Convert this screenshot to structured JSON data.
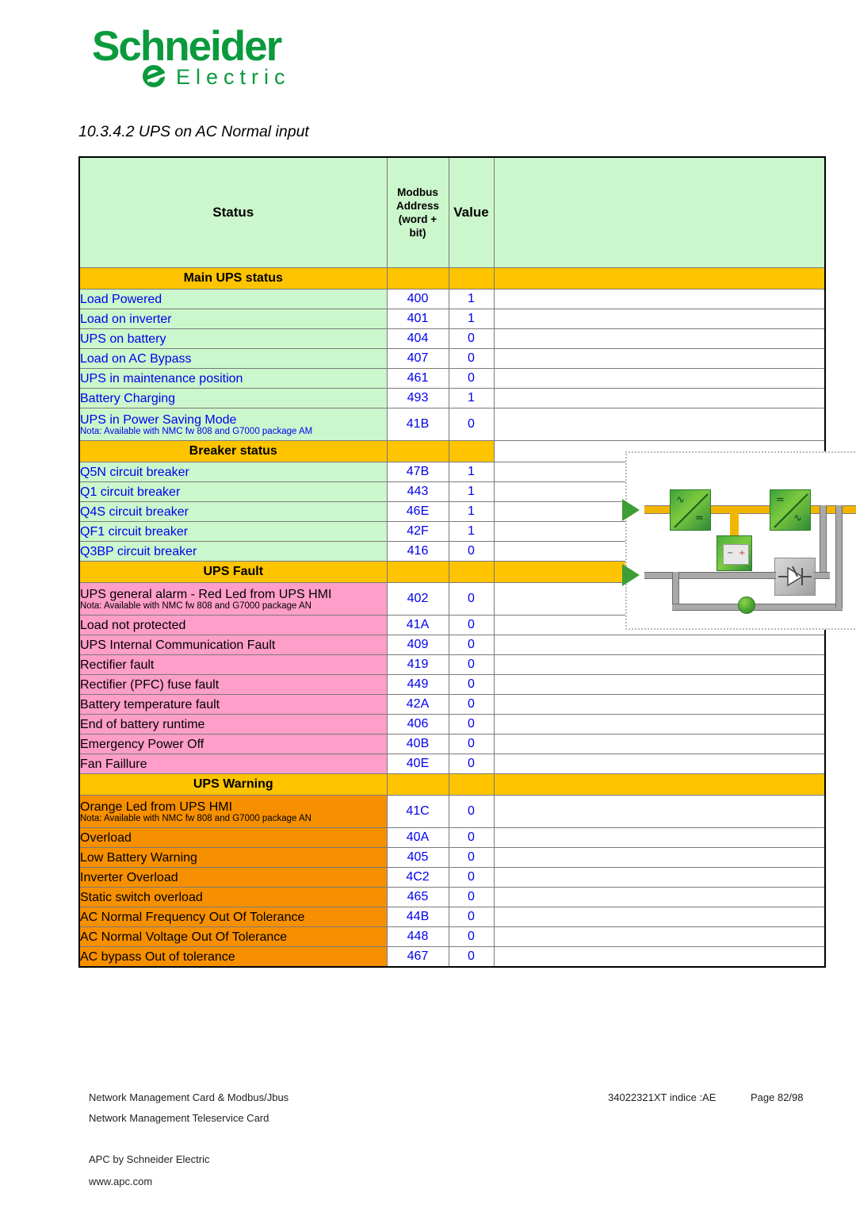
{
  "brand": {
    "name": "Schneider",
    "sub": "Electric",
    "green": "#0a9a3c"
  },
  "heading": "10.3.4.2 UPS on AC Normal input",
  "table": {
    "headers": {
      "status": "Status",
      "address": "Modbus Address (word + bit)",
      "address_lines": [
        "Modbus",
        "Address",
        "(word +",
        "bit)"
      ],
      "value": "Value",
      "diagram": ""
    },
    "sections": [
      {
        "title": "Main UPS status",
        "band_spans_diagram": true,
        "color": "#ccf6cc",
        "text_color": "#0000ee",
        "rows": [
          {
            "label": "Load Powered",
            "note": "",
            "address": "400",
            "value": "1"
          },
          {
            "label": "Load on inverter",
            "note": "",
            "address": "401",
            "value": "1"
          },
          {
            "label": "UPS on battery",
            "note": "",
            "address": "404",
            "value": "0"
          },
          {
            "label": "Load on AC Bypass",
            "note": "",
            "address": "407",
            "value": "0"
          },
          {
            "label": "UPS in maintenance position",
            "note": "",
            "address": "461",
            "value": "0"
          },
          {
            "label": "Battery Charging",
            "note": "",
            "address": "493",
            "value": "1"
          },
          {
            "label": "UPS in Power Saving Mode",
            "note": "Nota: Available with NMC fw 808 and G7000 package AM",
            "address": "41B",
            "value": "0"
          }
        ]
      },
      {
        "title": "Breaker status",
        "band_spans_diagram": false,
        "color": "#ccf6cc",
        "text_color": "#0000ee",
        "rows": [
          {
            "label": "Q5N circuit breaker",
            "note": "",
            "address": "47B",
            "value": "1"
          },
          {
            "label": "Q1 circuit breaker",
            "note": "",
            "address": "443",
            "value": "1"
          },
          {
            "label": "Q4S circuit breaker",
            "note": "",
            "address": "46E",
            "value": "1"
          },
          {
            "label": "QF1 circuit breaker",
            "note": "",
            "address": "42F",
            "value": "1"
          },
          {
            "label": "Q3BP circuit breaker",
            "note": "",
            "address": "416",
            "value": "0"
          }
        ]
      },
      {
        "title": "UPS Fault",
        "band_spans_diagram": true,
        "color": "#ff9ec8",
        "text_color": "#000000",
        "rows": [
          {
            "label": "UPS general alarm - Red Led from UPS HMI",
            "note": "Nota: Available with NMC fw 808 and G7000 package AN",
            "address": "402",
            "value": "0"
          },
          {
            "label": "Load not protected",
            "note": "",
            "address": "41A",
            "value": "0"
          },
          {
            "label": "UPS Internal Communication Fault",
            "note": "",
            "address": "409",
            "value": "0"
          },
          {
            "label": "Rectifier fault",
            "note": "",
            "address": "419",
            "value": "0"
          },
          {
            "label": "Rectifier (PFC) fuse fault",
            "note": "",
            "address": "449",
            "value": "0"
          },
          {
            "label": "Battery temperature fault",
            "note": "",
            "address": "42A",
            "value": "0"
          },
          {
            "label": "End of battery runtime",
            "note": "",
            "address": "406",
            "value": "0"
          },
          {
            "label": "Emergency Power Off",
            "note": "",
            "address": "40B",
            "value": "0"
          },
          {
            "label": "Fan Faillure",
            "note": "",
            "address": "40E",
            "value": "0"
          }
        ]
      },
      {
        "title": "UPS Warning",
        "band_spans_diagram": true,
        "color": "#f79000",
        "text_color": "#000000",
        "rows": [
          {
            "label": "Orange Led from UPS HMI",
            "note": "Nota: Available with NMC fw 808 and G7000 package AN",
            "address": "41C",
            "value": "0"
          },
          {
            "label": "Overload",
            "note": "",
            "address": "40A",
            "value": "0"
          },
          {
            "label": "Low Battery Warning",
            "note": "",
            "address": "405",
            "value": "0"
          },
          {
            "label": "Inverter Overload",
            "note": "",
            "address": "4C2",
            "value": "0"
          },
          {
            "label": "Static switch overload",
            "note": "",
            "address": "465",
            "value": "0"
          },
          {
            "label": "AC Normal Frequency Out Of Tolerance",
            "note": "",
            "address": "44B",
            "value": "0"
          },
          {
            "label": "AC Normal Voltage Out Of Tolerance",
            "note": "",
            "address": "448",
            "value": "0"
          },
          {
            "label": "AC bypass Out of tolerance",
            "note": "",
            "address": "467",
            "value": "0"
          }
        ]
      }
    ]
  },
  "diagram": {
    "name": "ups-single-line-diagram",
    "blocks": [
      "rectifier",
      "inverter",
      "battery",
      "static-switch",
      "earth"
    ],
    "symbols": {
      "rectifier_in": "∿",
      "rectifier_out": "=",
      "inverter_in": "=",
      "inverter_out": "∿"
    }
  },
  "footer": {
    "line1_left": "Network Management Card & Modbus/Jbus",
    "line1_mid": "34022321XT indice :AE",
    "line1_right": "Page 82/98",
    "line2": "Network Management Teleservice Card",
    "line3": "APC by Schneider Electric",
    "line4": "www.apc.com"
  },
  "colors": {
    "band": "#ffc400",
    "green_row": "#ccf6cc",
    "pink_row": "#ff9ec8",
    "orange_row": "#f79000",
    "link_blue": "#0000ee",
    "brand_green": "#0a9a3c"
  }
}
